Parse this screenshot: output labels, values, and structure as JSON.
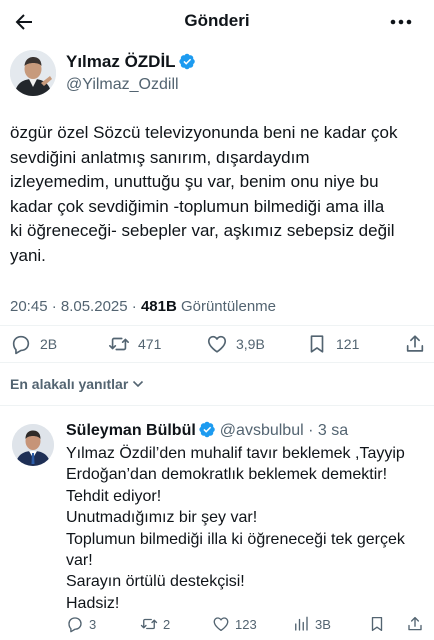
{
  "header": {
    "title": "Gönderi"
  },
  "tweet": {
    "author_name": "Yılmaz ÖZDİL",
    "author_handle": "@Yilmaz_Ozdill",
    "text_lines": [
      "özgür özel Sözcü televizyonunda beni ne kadar çok",
      "sevdiğini anlatmış sanırım, dışardaydım",
      "izleyemedim, unuttuğu şu var, benim onu niye bu",
      "kadar çok sevdiğimin -toplumun bilmediği ama illa",
      "ki öğreneceği- sebepler var, aşkımız sebepsiz değil",
      "yani."
    ],
    "time": "20:45 · 8.05.2025 · ",
    "views_count": "481B",
    "views_label": " Görüntülenme",
    "replies": "2B",
    "retweets": "471",
    "likes": "3,9B",
    "bookmarks": "121"
  },
  "sort_label": "En alakalı yanıtlar",
  "reply": {
    "author_name": "Süleyman Bülbül",
    "author_handle": "@avsbulbul",
    "time": " · 3 sa",
    "text_lines": [
      "Yılmaz Özdil’den  muhalif tavır beklemek ,Tayyip",
      "Erdoğan’dan demokratlık beklemek demektir!",
      "Tehdit ediyor!",
      "Unutmadığımız bir şey var!",
      "Toplumun bilmediği illa ki öğreneceği tek gerçek",
      "var!",
      "Sarayın örtülü destekçisi!",
      "Hadsiz!"
    ],
    "replies": "3",
    "retweets": "2",
    "likes": "123",
    "views": "3B"
  },
  "colors": {
    "verified": "#1d9bf0",
    "muted": "#536471",
    "text": "#0f1419"
  }
}
